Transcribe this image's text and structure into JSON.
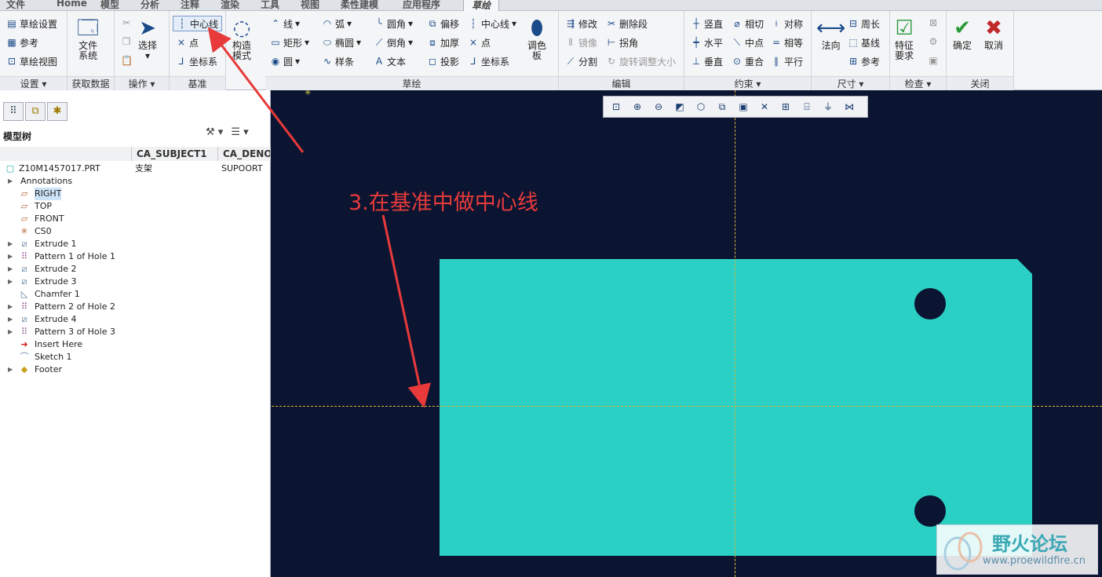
{
  "menu": {
    "tabs": [
      "文件",
      "Home",
      "模型",
      "分析",
      "注释",
      "渲染",
      "工具",
      "视图",
      "柔性建模",
      "应用程序",
      "草绘"
    ]
  },
  "ribbon": {
    "setup": {
      "items": [
        "草绘设置",
        "参考",
        "草绘视图"
      ],
      "label": "设置"
    },
    "getdata": {
      "file_system": "文件\n系统",
      "label": "获取数据"
    },
    "operations": {
      "select": "选择",
      "label": "操作"
    },
    "datum": {
      "centerline": "中心线",
      "point": "点",
      "coordsys": "坐标系",
      "label": "基准"
    },
    "construct_mode": "构造\n模式",
    "sketch": {
      "col1": [
        "线",
        "矩形",
        "圆"
      ],
      "col2": [
        "弧",
        "椭圆",
        "样条"
      ],
      "col3": [
        "圆角",
        "倒角",
        "文本"
      ],
      "col4": [
        "偏移",
        "加厚",
        "投影"
      ],
      "col5": [
        "中心线",
        "点",
        "坐标系"
      ],
      "palette": "调色\n板",
      "label": "草绘"
    },
    "edit": {
      "col1": [
        "修改",
        "镜像",
        "分割"
      ],
      "col2": [
        "删除段",
        "拐角",
        "旋转调整大小"
      ],
      "label": "编辑"
    },
    "constrain": {
      "col1": [
        "竖直",
        "水平",
        "垂直"
      ],
      "col2": [
        "相切",
        "中点",
        "重合"
      ],
      "col3": [
        "对称",
        "相等",
        "平行"
      ],
      "label": "约束"
    },
    "dimension": {
      "normal": "法向",
      "items": [
        "周长",
        "基线",
        "参考"
      ],
      "label": "尺寸"
    },
    "inspect": {
      "feature_req": "特征\n要求",
      "label": "检查"
    },
    "close": {
      "ok": "确定",
      "cancel": "取消",
      "label": "关闭"
    }
  },
  "model_tree": {
    "title": "模型树",
    "columns": [
      "CA_SUBJECT1",
      "CA_DENO"
    ],
    "root": {
      "name": "Z10M1457017.PRT",
      "c1": "支架",
      "c2": "SUPOORT"
    },
    "items": [
      {
        "name": "Annotations",
        "expand": true
      },
      {
        "name": "RIGHT",
        "expand": false,
        "selected": true
      },
      {
        "name": "TOP",
        "expand": false
      },
      {
        "name": "FRONT",
        "expand": false
      },
      {
        "name": "CS0",
        "expand": false
      },
      {
        "name": "Extrude 1",
        "expand": true
      },
      {
        "name": "Pattern 1 of Hole 1",
        "expand": true
      },
      {
        "name": "Extrude 2",
        "expand": true
      },
      {
        "name": "Extrude 3",
        "expand": true
      },
      {
        "name": "Chamfer 1",
        "expand": false
      },
      {
        "name": "Pattern 2 of Hole 2",
        "expand": true
      },
      {
        "name": "Extrude 4",
        "expand": true
      },
      {
        "name": "Pattern 3 of Hole 3",
        "expand": true
      },
      {
        "name": "Insert Here",
        "expand": false
      },
      {
        "name": "Sketch 1",
        "expand": false
      },
      {
        "name": "Footer",
        "expand": true
      }
    ]
  },
  "canvas": {
    "annotation": "3.在基准中做中心线",
    "part_color": "#2ad0c4",
    "background_color": "#0b1532"
  },
  "watermark": {
    "name": "野火论坛",
    "url": "www.proewildfire.cn"
  },
  "accent_color": "#e83a3a"
}
